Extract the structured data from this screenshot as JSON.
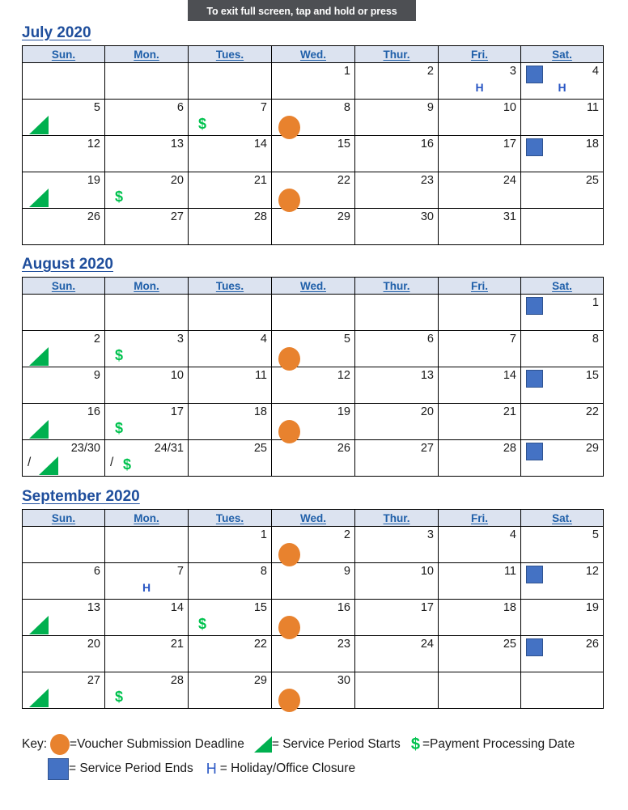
{
  "toast": {
    "message": "To exit full screen, tap and hold or press"
  },
  "weekdays": [
    "Sun.",
    "Mon.",
    "Tues.",
    "Wed.",
    "Thur.",
    "Fri.",
    "Sat."
  ],
  "colors": {
    "circle_orange": "#E8822E",
    "triangle_green": "#00B04F",
    "dollar_green": "#00C24E",
    "square_blue": "#4472C4",
    "holiday_blue": "#2A57C4",
    "title_blue": "#1F4E9C",
    "header_text_blue": "#1F5FA9",
    "header_fill": "#DCE3F0",
    "toast_gray": "#4D4F53"
  },
  "months": [
    {
      "title": "July 2020",
      "weeks": [
        [
          {
            "num": "",
            "markers": []
          },
          {
            "num": "",
            "markers": []
          },
          {
            "num": "",
            "markers": []
          },
          {
            "num": "1",
            "markers": []
          },
          {
            "num": "2",
            "markers": []
          },
          {
            "num": "3",
            "markers": [
              "holiday"
            ]
          },
          {
            "num": "4",
            "markers": [
              "square",
              "holiday"
            ]
          }
        ],
        [
          {
            "num": "5",
            "markers": [
              "triangle"
            ]
          },
          {
            "num": "6",
            "markers": []
          },
          {
            "num": "7",
            "markers": [
              "dollar"
            ]
          },
          {
            "num": "8",
            "markers": [
              "circle"
            ]
          },
          {
            "num": "9",
            "markers": []
          },
          {
            "num": "10",
            "markers": []
          },
          {
            "num": "11",
            "markers": []
          }
        ],
        [
          {
            "num": "12",
            "markers": []
          },
          {
            "num": "13",
            "markers": []
          },
          {
            "num": "14",
            "markers": []
          },
          {
            "num": "15",
            "markers": []
          },
          {
            "num": "16",
            "markers": []
          },
          {
            "num": "17",
            "markers": []
          },
          {
            "num": "18",
            "markers": [
              "square"
            ]
          }
        ],
        [
          {
            "num": "19",
            "markers": [
              "triangle"
            ]
          },
          {
            "num": "20",
            "markers": [
              "dollar"
            ]
          },
          {
            "num": "21",
            "markers": []
          },
          {
            "num": "22",
            "markers": [
              "circle"
            ]
          },
          {
            "num": "23",
            "markers": []
          },
          {
            "num": "24",
            "markers": []
          },
          {
            "num": "25",
            "markers": []
          }
        ],
        [
          {
            "num": "26",
            "markers": []
          },
          {
            "num": "27",
            "markers": []
          },
          {
            "num": "28",
            "markers": []
          },
          {
            "num": "29",
            "markers": []
          },
          {
            "num": "30",
            "markers": []
          },
          {
            "num": "31",
            "markers": []
          },
          {
            "num": "",
            "markers": []
          }
        ]
      ]
    },
    {
      "title": "August 2020",
      "weeks": [
        [
          {
            "num": "",
            "markers": []
          },
          {
            "num": "",
            "markers": []
          },
          {
            "num": "",
            "markers": []
          },
          {
            "num": "",
            "markers": []
          },
          {
            "num": "",
            "markers": []
          },
          {
            "num": "",
            "markers": []
          },
          {
            "num": "1",
            "markers": [
              "square"
            ]
          }
        ],
        [
          {
            "num": "2",
            "markers": [
              "triangle"
            ]
          },
          {
            "num": "3",
            "markers": [
              "dollar"
            ]
          },
          {
            "num": "4",
            "markers": []
          },
          {
            "num": "5",
            "markers": [
              "circle"
            ]
          },
          {
            "num": "6",
            "markers": []
          },
          {
            "num": "7",
            "markers": []
          },
          {
            "num": "8",
            "markers": []
          }
        ],
        [
          {
            "num": "9",
            "markers": []
          },
          {
            "num": "10",
            "markers": []
          },
          {
            "num": "11",
            "markers": []
          },
          {
            "num": "12",
            "markers": []
          },
          {
            "num": "13",
            "markers": []
          },
          {
            "num": "14",
            "markers": []
          },
          {
            "num": "15",
            "markers": [
              "square"
            ]
          }
        ],
        [
          {
            "num": "16",
            "markers": [
              "triangle"
            ]
          },
          {
            "num": "17",
            "markers": [
              "dollar"
            ]
          },
          {
            "num": "18",
            "markers": []
          },
          {
            "num": "19",
            "markers": [
              "circle"
            ]
          },
          {
            "num": "20",
            "markers": []
          },
          {
            "num": "21",
            "markers": []
          },
          {
            "num": "22",
            "markers": []
          }
        ],
        [
          {
            "num": "23/30",
            "markers": [
              "slash",
              "triangle-after-slash"
            ]
          },
          {
            "num": "24/31",
            "markers": [
              "slash",
              "dollar-after-slash"
            ]
          },
          {
            "num": "25",
            "markers": []
          },
          {
            "num": "26",
            "markers": []
          },
          {
            "num": "27",
            "markers": []
          },
          {
            "num": "28",
            "markers": []
          },
          {
            "num": "29",
            "markers": [
              "square"
            ]
          }
        ]
      ]
    },
    {
      "title": "September 2020",
      "weeks": [
        [
          {
            "num": "",
            "markers": []
          },
          {
            "num": "",
            "markers": []
          },
          {
            "num": "1",
            "markers": []
          },
          {
            "num": "2",
            "markers": [
              "circle"
            ]
          },
          {
            "num": "3",
            "markers": []
          },
          {
            "num": "4",
            "markers": []
          },
          {
            "num": "5",
            "markers": []
          }
        ],
        [
          {
            "num": "6",
            "markers": []
          },
          {
            "num": "7",
            "markers": [
              "holiday"
            ]
          },
          {
            "num": "8",
            "markers": []
          },
          {
            "num": "9",
            "markers": []
          },
          {
            "num": "10",
            "markers": []
          },
          {
            "num": "11",
            "markers": []
          },
          {
            "num": "12",
            "markers": [
              "square"
            ]
          }
        ],
        [
          {
            "num": "13",
            "markers": [
              "triangle"
            ]
          },
          {
            "num": "14",
            "markers": []
          },
          {
            "num": "15",
            "markers": [
              "dollar"
            ]
          },
          {
            "num": "16",
            "markers": [
              "circle"
            ]
          },
          {
            "num": "17",
            "markers": []
          },
          {
            "num": "18",
            "markers": []
          },
          {
            "num": "19",
            "markers": []
          }
        ],
        [
          {
            "num": "20",
            "markers": []
          },
          {
            "num": "21",
            "markers": []
          },
          {
            "num": "22",
            "markers": []
          },
          {
            "num": "23",
            "markers": []
          },
          {
            "num": "24",
            "markers": []
          },
          {
            "num": "25",
            "markers": []
          },
          {
            "num": "26",
            "markers": [
              "square"
            ]
          }
        ],
        [
          {
            "num": "27",
            "markers": [
              "triangle"
            ]
          },
          {
            "num": "28",
            "markers": [
              "dollar"
            ]
          },
          {
            "num": "29",
            "markers": []
          },
          {
            "num": "30",
            "markers": [
              "circle"
            ]
          },
          {
            "num": "",
            "markers": []
          },
          {
            "num": "",
            "markers": []
          },
          {
            "num": "",
            "markers": []
          }
        ]
      ]
    }
  ],
  "key": {
    "label": "Key:",
    "items": [
      {
        "icon": "circle",
        "text": "=Voucher Submission Deadline"
      },
      {
        "icon": "triangle",
        "text": "= Service Period Starts"
      },
      {
        "icon": "dollar",
        "text": "=Payment Processing Date"
      },
      {
        "icon": "square",
        "text": "= Service Period Ends"
      },
      {
        "icon": "holiday",
        "text": "= Holiday/Office Closure"
      }
    ],
    "holiday_glyph": "H"
  }
}
